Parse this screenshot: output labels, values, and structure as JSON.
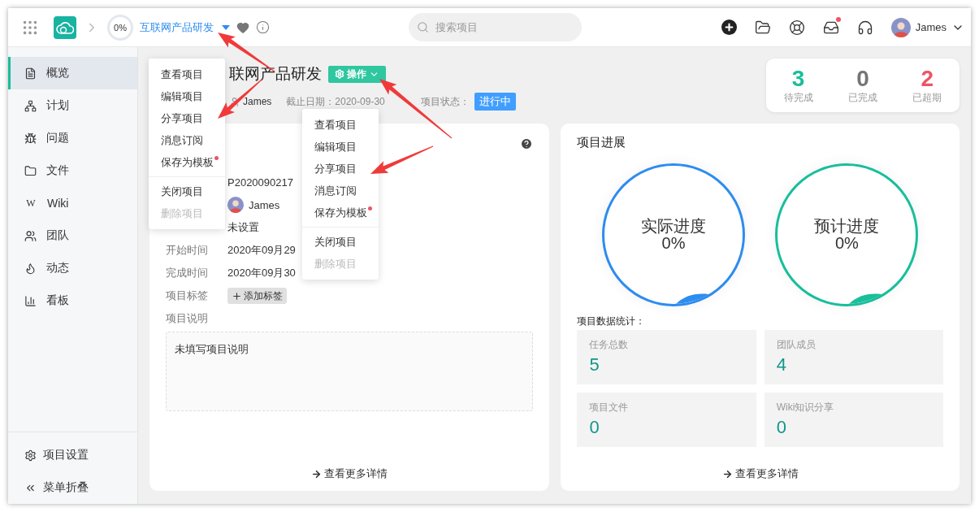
{
  "header": {
    "progress": "0%",
    "project": "互联网产品研发",
    "search": {
      "placeholder": "搜索项目"
    },
    "inbox_unread": true,
    "user": "James"
  },
  "sidebar": {
    "items": [
      {
        "kind": "overview",
        "label": "概览",
        "selected": true
      },
      {
        "kind": "plan",
        "label": "计划",
        "selected": false
      },
      {
        "kind": "issue",
        "label": "问题",
        "selected": false
      },
      {
        "kind": "file",
        "label": "文件",
        "selected": false
      },
      {
        "kind": "wiki",
        "glyph": "W",
        "label": "Wiki",
        "selected": false
      },
      {
        "kind": "team",
        "label": "团队",
        "selected": false
      },
      {
        "kind": "activity",
        "label": "动态",
        "selected": false
      },
      {
        "kind": "board",
        "label": "看板",
        "selected": false
      }
    ],
    "footer": [
      {
        "kind": "settings",
        "label": "项目设置"
      },
      {
        "kind": "collapse",
        "label": "菜单折叠"
      }
    ]
  },
  "project": {
    "title": "联网产品研发",
    "action_button": "操作",
    "owner": "James",
    "deadline": "截止日期：2020-09-30",
    "status_label": "项目状态：",
    "status": "进行中"
  },
  "counters": [
    {
      "value": "3",
      "label": "待完成",
      "color": "#19be9b"
    },
    {
      "value": "0",
      "label": "已完成",
      "color": "#757575"
    },
    {
      "value": "2",
      "label": "已超期",
      "color": "#ed5565"
    }
  ],
  "info_card": {
    "rows": [
      {
        "kind": "text",
        "value": "P2020090217"
      },
      {
        "kind": "user",
        "value": "James"
      },
      {
        "kind": "text",
        "value": "未设置"
      },
      {
        "kind": "text",
        "label": "开始时间",
        "value": "2020年09月29"
      },
      {
        "kind": "text",
        "label": "完成时间",
        "value": "2020年09月30"
      },
      {
        "kind": "tag",
        "label": "项目标签",
        "value": "添加标签"
      }
    ],
    "description_label": "项目说明",
    "description": "未填写项目说明",
    "more": "查看更多详情"
  },
  "menus": [
    {
      "groups": [
        [
          {
            "label": "查看项目",
            "disabled": false,
            "badge": false
          },
          {
            "label": "编辑项目",
            "disabled": false,
            "badge": false
          },
          {
            "label": "分享项目",
            "disabled": false,
            "badge": false
          },
          {
            "label": "消息订阅",
            "disabled": false,
            "badge": false
          },
          {
            "label": "保存为模板",
            "disabled": false,
            "badge": true
          }
        ],
        [
          {
            "label": "关闭项目",
            "disabled": false,
            "badge": false
          },
          {
            "label": "删除项目",
            "disabled": true,
            "badge": false
          }
        ]
      ]
    },
    {
      "groups": [
        [
          {
            "label": "查看项目",
            "disabled": false,
            "badge": false
          },
          {
            "label": "编辑项目",
            "disabled": false,
            "badge": false
          },
          {
            "label": "分享项目",
            "disabled": false,
            "badge": false
          },
          {
            "label": "消息订阅",
            "disabled": false,
            "badge": false
          },
          {
            "label": "保存为模板",
            "disabled": false,
            "badge": true
          }
        ],
        [
          {
            "label": "关闭项目",
            "disabled": false,
            "badge": false
          },
          {
            "label": "删除项目",
            "disabled": true,
            "badge": false
          }
        ]
      ]
    }
  ],
  "progress_card": {
    "title": "项目进展",
    "gauges": [
      {
        "label": "实际进度",
        "value": "0%",
        "color": "#2d8cf0"
      },
      {
        "label": "预计进度",
        "value": "0%",
        "color": "#19be9b"
      }
    ],
    "stats_title": "项目数据统计：",
    "stats": [
      {
        "label": "任务总数",
        "value": "5"
      },
      {
        "label": "团队成员",
        "value": "4"
      },
      {
        "label": "项目文件",
        "value": "0"
      },
      {
        "label": "Wiki知识分享",
        "value": "0"
      }
    ],
    "more": "查看更多详情"
  }
}
